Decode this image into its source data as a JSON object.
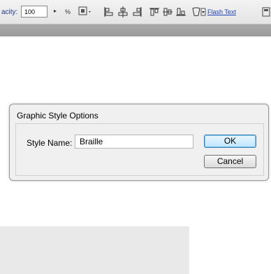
{
  "toolbar": {
    "opacity_label": "acity:",
    "opacity_value": "100",
    "percent_symbol": "%",
    "flash_text_label": "Flash Text",
    "icons": [
      "transform-icon",
      "align-left-icon",
      "align-center-icon",
      "align-right-icon",
      "align-top-icon",
      "align-middle-icon",
      "align-bottom-icon",
      "envelope-icon",
      "dock-icon"
    ]
  },
  "dialog": {
    "title": "Graphic Style Options",
    "style_name_label": "Style Name:",
    "style_name_value": "Braille",
    "ok_label": "OK",
    "cancel_label": "Cancel"
  }
}
